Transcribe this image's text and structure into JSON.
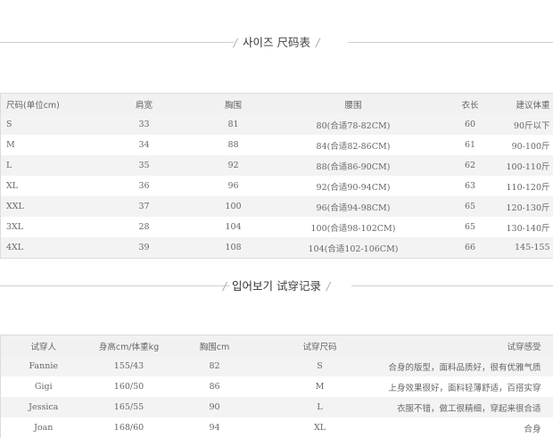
{
  "size_section": {
    "title_kr": "사이즈",
    "title_cn": "尺码表",
    "headers": [
      "尺码(单位cm)",
      "肩宽",
      "胸围",
      "腰围",
      "衣长",
      "建议体重"
    ],
    "rows": [
      [
        "S",
        "33",
        "81",
        "80(合适78-82CM)",
        "60",
        "90斤以下"
      ],
      [
        "M",
        "34",
        "88",
        "84(合适82-86CM)",
        "61",
        "90-100斤"
      ],
      [
        "L",
        "35",
        "92",
        "88(合适86-90CM)",
        "62",
        "100-110斤"
      ],
      [
        "XL",
        "36",
        "96",
        "92(合适90-94CM)",
        "63",
        "110-120斤"
      ],
      [
        "XXL",
        "37",
        "100",
        "96(合适94-98CM)",
        "65",
        "120-130斤"
      ],
      [
        "3XL",
        "28",
        "104",
        "100(合适98-102CM)",
        "65",
        "130-140斤"
      ],
      [
        "4XL",
        "39",
        "108",
        "104(合适102-106CM)",
        "66",
        "145-155"
      ]
    ]
  },
  "trial_section": {
    "title_kr": "입어보기",
    "title_cn": "试穿记录",
    "headers": [
      "试穿人",
      "身高cm/体重kg",
      "胸围cm",
      "试穿尺码",
      "试穿感受"
    ],
    "rows": [
      [
        "Fannie",
        "155/43",
        "82",
        "S",
        "合身的版型，面料品质好，很有优雅气质"
      ],
      [
        "Gigi",
        "160/50",
        "86",
        "M",
        "上身效果很好，面料轻薄舒适，百搭实穿"
      ],
      [
        "Jessica",
        "165/55",
        "90",
        "L",
        "衣服不错，做工很精细，穿起来很合适"
      ],
      [
        "Joan",
        "168/60",
        "94",
        "XL",
        "合身"
      ]
    ]
  }
}
